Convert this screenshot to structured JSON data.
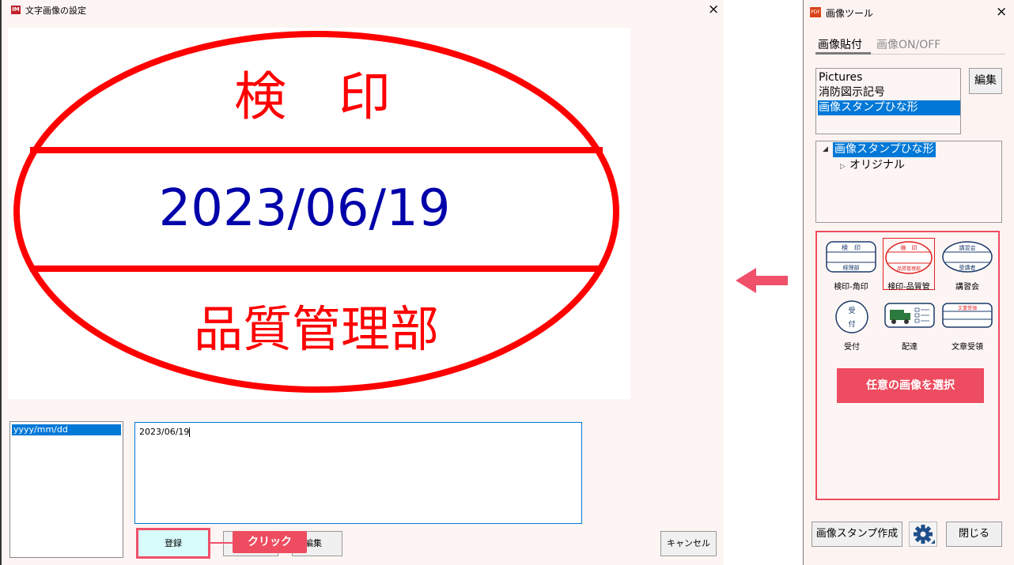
{
  "dialog": {
    "icon_text": "IM",
    "title": "文字画像の設定",
    "close": "×",
    "stamp": {
      "top_text": "検　印",
      "date": "2023/06/19",
      "bottom_text": "品質管理部",
      "outline_color": "#ff0000",
      "date_color": "#0000aa"
    },
    "format_list": [
      "yyyy/mm/dd"
    ],
    "text_value": "2023/06/19",
    "register_label": "登録",
    "image_edit_label": "像編集",
    "cancel_label": "キャンセル",
    "callout": "クリック"
  },
  "tool": {
    "icon_text": "PDF",
    "title": "画像ツール",
    "close": "×",
    "tabs": [
      "画像貼付",
      "画像ON/OFF"
    ],
    "categories": [
      "Pictures",
      "消防図示記号",
      "画像スタンプひな形"
    ],
    "edit_label": "編集",
    "tree_root": "画像スタンプひな形",
    "tree_child": "オリジナル",
    "thumbnails": [
      {
        "label": "検印-角印",
        "top": "検　印",
        "bottom": "経理部"
      },
      {
        "label": "検印-品質管",
        "top": "検　印",
        "bottom": "品質管理部"
      },
      {
        "label": "講習会",
        "top": "講習会",
        "bottom": "受講者"
      },
      {
        "label": "受付",
        "top": "受",
        "bottom": "付"
      },
      {
        "label": "配達",
        "top": "",
        "bottom": ""
      },
      {
        "label": "文章受領",
        "top": "文書受領",
        "bottom": ""
      }
    ],
    "select_image_label": "任意の画像を選択",
    "stamp_create_label": "画像スタンプ作成",
    "close_label": "閉じる"
  },
  "colors": {
    "accent": "#ee4c60",
    "selection": "#0078d7"
  }
}
